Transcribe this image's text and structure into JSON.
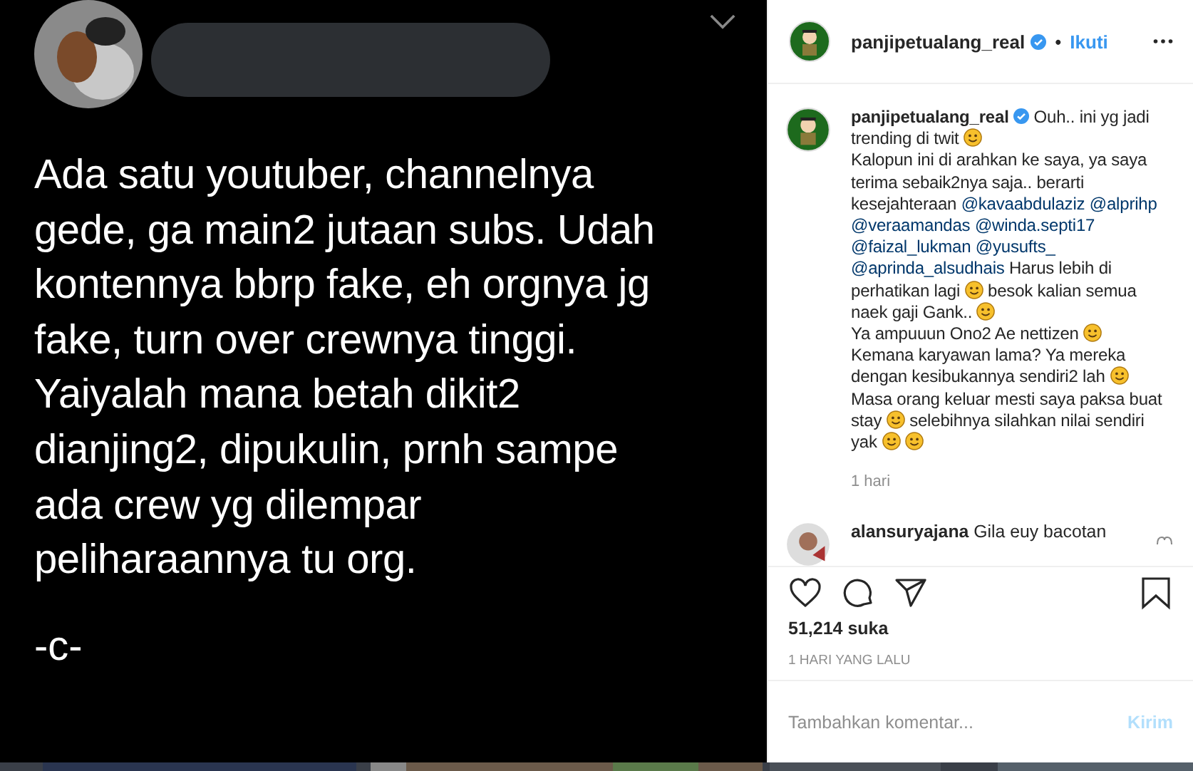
{
  "tweet": {
    "lines": [
      "Ada satu youtuber, channelnya",
      "gede, ga main2 jutaan subs. Udah",
      "kontennya bbrp fake, eh orgnya jg",
      "fake, turn over crewnya tinggi.",
      "Yaiyalah mana betah dikit2",
      "dianjing2, dipukulin, prnh sampe",
      "ada  crew yg dilempar",
      "peliharaannya tu org."
    ],
    "signature": "-c-"
  },
  "header": {
    "username": "panjipetualang_real",
    "verified": true,
    "separator": "•",
    "follow": "Ikuti"
  },
  "caption": {
    "username": "panjipetualang_real",
    "verified": true,
    "segments": [
      {
        "kind": "text",
        "text": "Ouh.. ini yg jadi trending di twit"
      },
      {
        "kind": "emoji"
      },
      {
        "kind": "break"
      },
      {
        "kind": "text",
        "text": "Kalopun ini di arahkan ke saya, ya saya terima sebaik2nya saja.. berarti kesejahteraan"
      },
      {
        "kind": "mention",
        "text": "@kavaabdulaziz"
      },
      {
        "kind": "mention",
        "text": "@alprihp"
      },
      {
        "kind": "mention",
        "text": "@veraamandas"
      },
      {
        "kind": "mention",
        "text": "@winda.septi17"
      },
      {
        "kind": "mention",
        "text": "@faizal_lukman"
      },
      {
        "kind": "mention",
        "text": "@yusufts_"
      },
      {
        "kind": "mention",
        "text": "@aprinda_alsudhais"
      },
      {
        "kind": "text",
        "text": "Harus lebih di perhatikan lagi"
      },
      {
        "kind": "emoji"
      },
      {
        "kind": "text",
        "text": "besok kalian semua naek gaji Gank.."
      },
      {
        "kind": "emoji"
      },
      {
        "kind": "break"
      },
      {
        "kind": "text",
        "text": "Ya ampuuun Ono2 Ae nettizen"
      },
      {
        "kind": "emoji"
      },
      {
        "kind": "break"
      },
      {
        "kind": "text",
        "text": "Kemana karyawan lama? Ya mereka dengan kesibukannya sendiri2 lah"
      },
      {
        "kind": "emoji"
      },
      {
        "kind": "break"
      },
      {
        "kind": "text",
        "text": "Masa orang keluar mesti saya paksa buat stay"
      },
      {
        "kind": "emoji"
      },
      {
        "kind": "text",
        "text": "selebihnya silahkan nilai sendiri yak"
      },
      {
        "kind": "emoji"
      },
      {
        "kind": "emoji"
      }
    ],
    "time": "1 hari"
  },
  "comment": {
    "username": "alansuryajana",
    "text": "Gila euy bacotan"
  },
  "likes": "51,214 suka",
  "posted": "1 HARI YANG LALU",
  "input": {
    "placeholder": "Tambahkan komentar...",
    "send": "Kirim"
  }
}
